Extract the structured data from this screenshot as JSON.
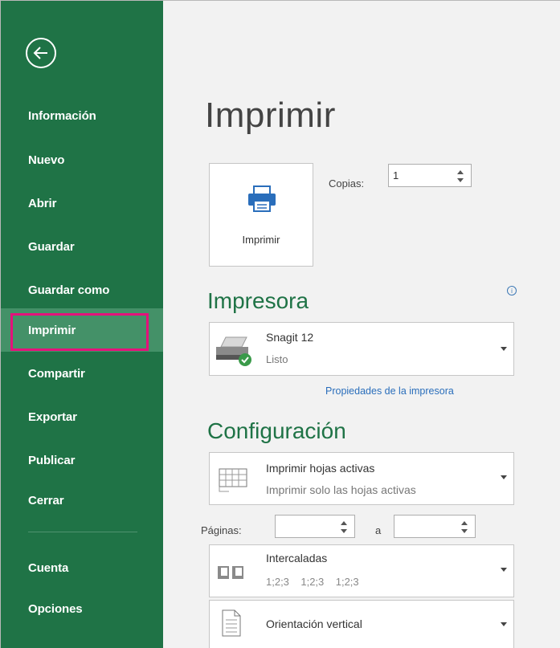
{
  "sidebar": {
    "items": [
      {
        "label": "Información"
      },
      {
        "label": "Nuevo"
      },
      {
        "label": "Abrir"
      },
      {
        "label": "Guardar"
      },
      {
        "label": "Guardar como"
      },
      {
        "label": "Imprimir",
        "active": true
      },
      {
        "label": "Compartir"
      },
      {
        "label": "Exportar"
      },
      {
        "label": "Publicar"
      },
      {
        "label": "Cerrar"
      },
      {
        "label": "Cuenta"
      },
      {
        "label": "Opciones"
      }
    ],
    "back_icon": "arrow-left-circle-icon",
    "color": "#1f7346",
    "active_color": "#449168",
    "highlight_color": "#e4127b"
  },
  "main": {
    "title": "Imprimir",
    "print_button": {
      "label": "Imprimir",
      "icon": "printer-icon"
    },
    "copies": {
      "label": "Copias:",
      "value": "1"
    },
    "printer_section": {
      "title": "Impresora",
      "info_icon": "info-icon",
      "printer": {
        "name": "Snagit 12",
        "status": "Listo",
        "icon": "printer-ready-icon"
      },
      "properties_link": "Propiedades de la impresora"
    },
    "settings_section": {
      "title": "Configuración",
      "what_to_print": {
        "main": "Imprimir hojas activas",
        "sub": "Imprimir solo las hojas activas",
        "icon": "sheets-grid-icon"
      },
      "pages": {
        "label": "Páginas:",
        "from_value": "",
        "to_label": "a",
        "to_value": ""
      },
      "collation": {
        "main": "Intercaladas",
        "sub": "1;2;3    1;2;3    1;2;3",
        "icon": "collated-icon"
      },
      "orientation": {
        "main": "Orientación vertical",
        "icon": "portrait-page-icon"
      }
    },
    "accent_color": "#1f7346",
    "link_color": "#2a6ebb"
  }
}
